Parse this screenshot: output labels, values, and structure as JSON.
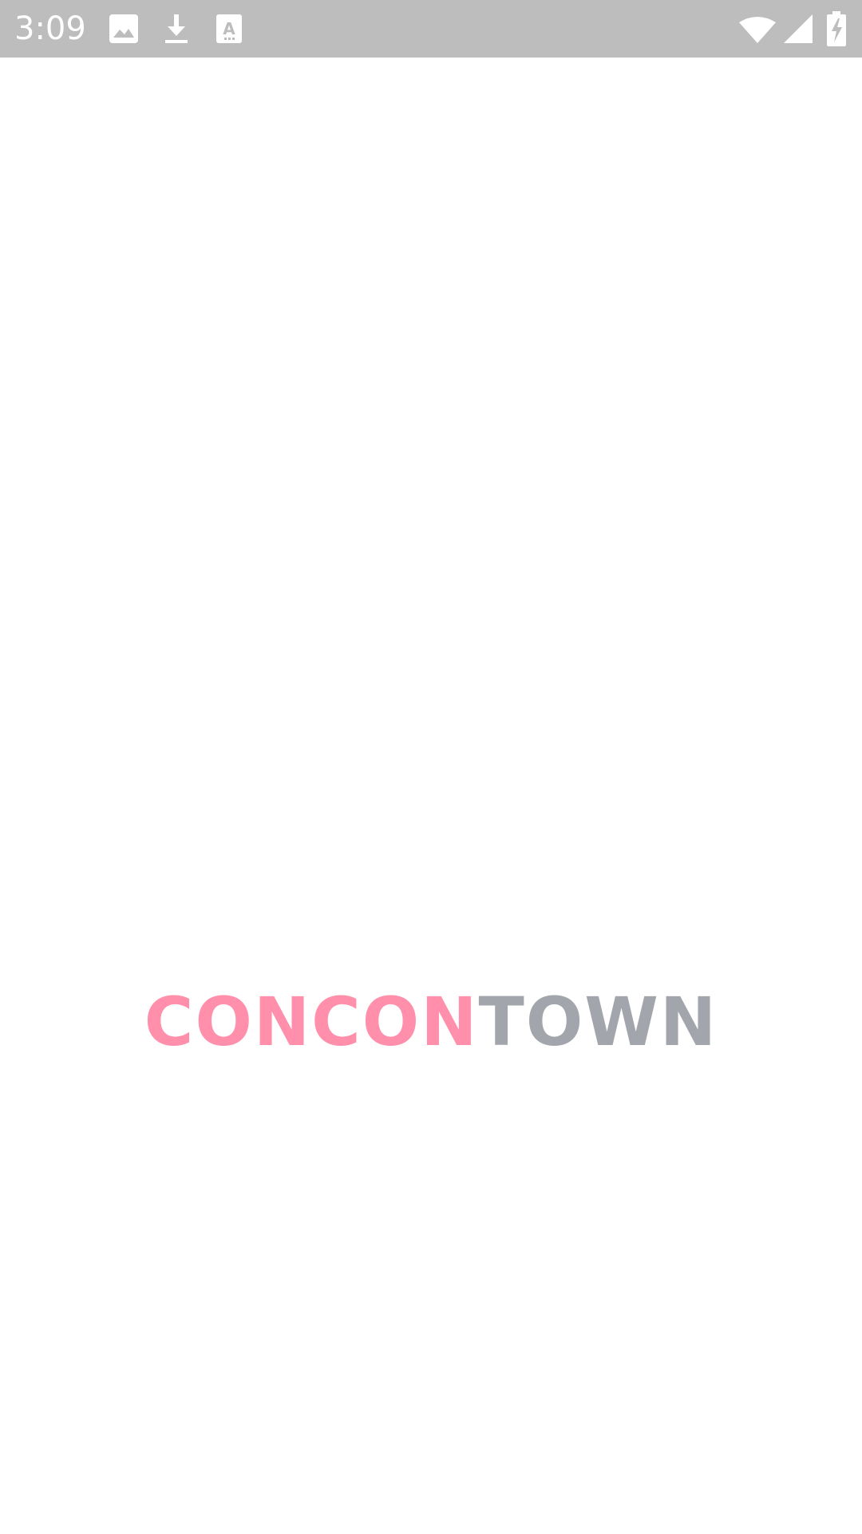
{
  "status_bar": {
    "time": "3:09",
    "background_color": "#bdbdbd",
    "left_icons": [
      "image-icon",
      "download-icon",
      "text-recognition-icon"
    ],
    "right_icons": [
      "wifi-icon",
      "signal-icon",
      "battery-charging-icon"
    ]
  },
  "logo": {
    "part_1": "CONCON",
    "part_2": "TOWN",
    "color_1": "#ff8fab",
    "color_2": "#a3a5ad"
  }
}
